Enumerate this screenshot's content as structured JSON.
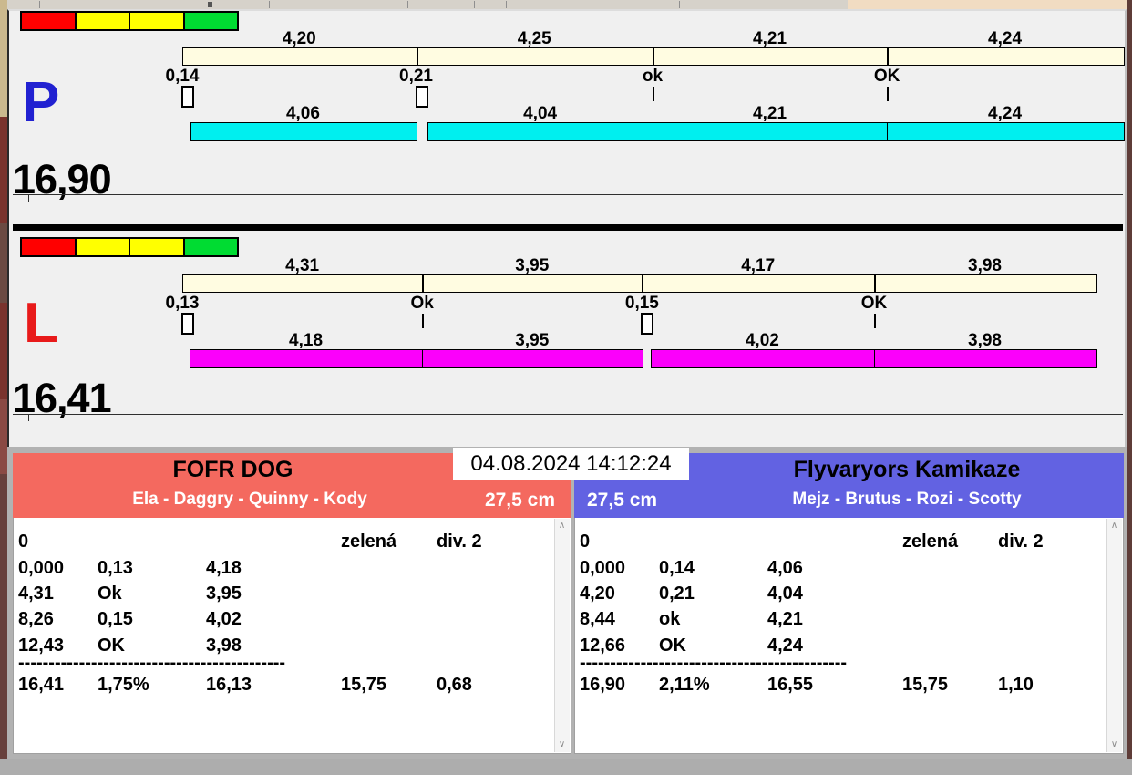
{
  "clock": "04.08.2024 14:12:24",
  "lanes": [
    {
      "letter": "P",
      "letter_color": "#2121D1",
      "bar_color": "#00EFEF",
      "total": "16,90",
      "traffic_lights": [
        "#FF0000",
        "#FFFF00",
        "#FFFF00",
        "#00DC32"
      ],
      "segments": [
        {
          "gross": "4,20",
          "crossing": "0,14",
          "net": "4,06"
        },
        {
          "gross": "4,25",
          "crossing": "0,21",
          "net": "4,04"
        },
        {
          "gross": "4,21",
          "crossing": "ok",
          "net": "4,21"
        },
        {
          "gross": "4,24",
          "crossing": "OK",
          "net": "4,24"
        }
      ]
    },
    {
      "letter": "L",
      "letter_color": "#E81A1A",
      "bar_color": "#FB00FB",
      "total": "16,41",
      "traffic_lights": [
        "#FF0000",
        "#FFFF00",
        "#FFFF00",
        "#00DC32"
      ],
      "segments": [
        {
          "gross": "4,31",
          "crossing": "0,13",
          "net": "4,18"
        },
        {
          "gross": "3,95",
          "crossing": "Ok",
          "net": "3,95"
        },
        {
          "gross": "4,17",
          "crossing": "0,15",
          "net": "4,02"
        },
        {
          "gross": "3,98",
          "crossing": "OK",
          "net": "3,98"
        }
      ]
    }
  ],
  "teams": [
    {
      "name": "FOFR DOG",
      "dogs": "Ela - Daggry - Quinny - Kody",
      "jump_height": "27,5 cm",
      "header_color": "#F4695F",
      "info_row": [
        "0",
        "",
        "",
        "zelená",
        "div. 2"
      ],
      "rows": [
        [
          "0,000",
          "0,13",
          "4,18",
          "",
          ""
        ],
        [
          "4,31",
          "Ok",
          "3,95",
          "",
          ""
        ],
        [
          "8,26",
          "0,15",
          "4,02",
          "",
          ""
        ],
        [
          "12,43",
          "OK",
          "3,98",
          "",
          ""
        ]
      ],
      "divider": "--------------------------------------------",
      "summary": [
        "16,41",
        "1,75%",
        "16,13",
        "15,75",
        "0,68"
      ]
    },
    {
      "name": "Flyvaryors Kamikaze",
      "dogs": "Mejz - Brutus - Rozi - Scotty",
      "jump_height": "27,5 cm",
      "header_color": "#6262E2",
      "info_row": [
        "0",
        "",
        "",
        "zelená",
        "div. 2"
      ],
      "rows": [
        [
          "0,000",
          "0,14",
          "4,06",
          "",
          ""
        ],
        [
          "4,20",
          "0,21",
          "4,04",
          "",
          ""
        ],
        [
          "8,44",
          "ok",
          "4,21",
          "",
          ""
        ],
        [
          "12,66",
          "OK",
          "4,24",
          "",
          ""
        ]
      ],
      "divider": "--------------------------------------------",
      "summary": [
        "16,90",
        "2,11%",
        "16,55",
        "15,75",
        "1,10"
      ]
    }
  ],
  "scrollbar": {
    "up": "∧",
    "down": "∨"
  }
}
